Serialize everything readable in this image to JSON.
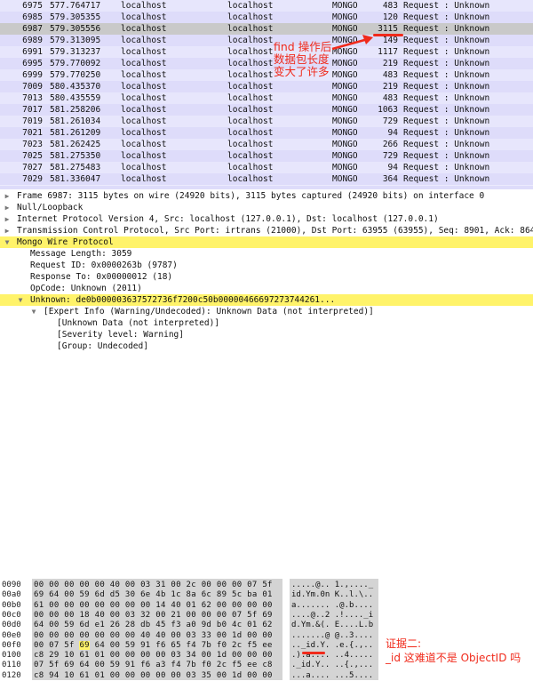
{
  "packet_list": {
    "rows": [
      {
        "no": "6975",
        "time": "577.764717",
        "src": "localhost",
        "dst": "localhost",
        "proto": "MONGO",
        "len": "483",
        "info": "Request : Unknown"
      },
      {
        "no": "6985",
        "time": "579.305355",
        "src": "localhost",
        "dst": "localhost",
        "proto": "MONGO",
        "len": "120",
        "info": "Request : Unknown"
      },
      {
        "no": "6987",
        "time": "579.305556",
        "src": "localhost",
        "dst": "localhost",
        "proto": "MONGO",
        "len": "3115",
        "info": "Request : Unknown",
        "selected": true
      },
      {
        "no": "6989",
        "time": "579.313095",
        "src": "localhost",
        "dst": "localhost",
        "proto": "MONGO",
        "len": "149",
        "info": "Request : Unknown"
      },
      {
        "no": "6991",
        "time": "579.313237",
        "src": "localhost",
        "dst": "localhost",
        "proto": "MONGO",
        "len": "1117",
        "info": "Request : Unknown"
      },
      {
        "no": "6995",
        "time": "579.770092",
        "src": "localhost",
        "dst": "localhost",
        "proto": "MONGO",
        "len": "219",
        "info": "Request : Unknown"
      },
      {
        "no": "6999",
        "time": "579.770250",
        "src": "localhost",
        "dst": "localhost",
        "proto": "MONGO",
        "len": "483",
        "info": "Request : Unknown"
      },
      {
        "no": "7009",
        "time": "580.435370",
        "src": "localhost",
        "dst": "localhost",
        "proto": "MONGO",
        "len": "219",
        "info": "Request : Unknown"
      },
      {
        "no": "7013",
        "time": "580.435559",
        "src": "localhost",
        "dst": "localhost",
        "proto": "MONGO",
        "len": "483",
        "info": "Request : Unknown"
      },
      {
        "no": "7017",
        "time": "581.258206",
        "src": "localhost",
        "dst": "localhost",
        "proto": "MONGO",
        "len": "1063",
        "info": "Request : Unknown"
      },
      {
        "no": "7019",
        "time": "581.261034",
        "src": "localhost",
        "dst": "localhost",
        "proto": "MONGO",
        "len": "729",
        "info": "Request : Unknown"
      },
      {
        "no": "7021",
        "time": "581.261209",
        "src": "localhost",
        "dst": "localhost",
        "proto": "MONGO",
        "len": "94",
        "info": "Request : Unknown"
      },
      {
        "no": "7023",
        "time": "581.262425",
        "src": "localhost",
        "dst": "localhost",
        "proto": "MONGO",
        "len": "266",
        "info": "Request : Unknown"
      },
      {
        "no": "7025",
        "time": "581.275350",
        "src": "localhost",
        "dst": "localhost",
        "proto": "MONGO",
        "len": "729",
        "info": "Request : Unknown"
      },
      {
        "no": "7027",
        "time": "581.275483",
        "src": "localhost",
        "dst": "localhost",
        "proto": "MONGO",
        "len": "94",
        "info": "Request : Unknown"
      },
      {
        "no": "7029",
        "time": "581.336047",
        "src": "localhost",
        "dst": "localhost",
        "proto": "MONGO",
        "len": "364",
        "info": "Request : Unknown"
      }
    ]
  },
  "annotation_find": [
    "find 操作后",
    "数据包长度",
    "变大了许多"
  ],
  "detail_tree": [
    {
      "indent": 0,
      "toggle": "closed",
      "text": "Frame 6987: 3115 bytes on wire (24920 bits), 3115 bytes captured (24920 bits) on interface 0"
    },
    {
      "indent": 0,
      "toggle": "closed",
      "text": "Null/Loopback"
    },
    {
      "indent": 0,
      "toggle": "closed",
      "text": "Internet Protocol Version 4, Src: localhost (127.0.0.1), Dst: localhost (127.0.0.1)"
    },
    {
      "indent": 0,
      "toggle": "closed",
      "text": "Transmission Control Protocol, Src Port: irtrans (21000), Dst Port: 63955 (63955), Seq: 8901, Ack: 864"
    },
    {
      "indent": 0,
      "toggle": "open",
      "text": "Mongo Wire Protocol",
      "highlight": true
    },
    {
      "indent": 1,
      "toggle": "",
      "text": "Message Length: 3059"
    },
    {
      "indent": 1,
      "toggle": "",
      "text": "Request ID: 0x0000263b (9787)"
    },
    {
      "indent": 1,
      "toggle": "",
      "text": "Response To: 0x00000012 (18)"
    },
    {
      "indent": 1,
      "toggle": "",
      "text": "OpCode: Unknown (2011)"
    },
    {
      "indent": 1,
      "toggle": "open",
      "text": "Unknown: de0b000003637572736f7200c50b00000466697273744261...",
      "highlight": true
    },
    {
      "indent": 2,
      "toggle": "open",
      "text": "[Expert Info (Warning/Undecoded): Unknown Data (not interpreted)]"
    },
    {
      "indent": 3,
      "toggle": "",
      "text": "[Unknown Data (not interpreted)]"
    },
    {
      "indent": 3,
      "toggle": "",
      "text": "[Severity level: Warning]"
    },
    {
      "indent": 3,
      "toggle": "",
      "text": "[Group: Undecoded]"
    }
  ],
  "bytes": [
    {
      "off": "0090",
      "hex": "00 00 00 00 00 40 00 03  31 00 2c 00 00 00 07 5f",
      "asc": ".....@..  1.,...._"
    },
    {
      "off": "00a0",
      "hex": "69 64 00 59 6d d5 30 6e  4b 1c 8a 6c 89 5c ba 01",
      "asc": "id.Ym.0n  K..l.\\.."
    },
    {
      "off": "00b0",
      "hex": "61 00 00 00 00 00 00 00  14 40 01 62 00 00 00 00",
      "asc": "a.......  .@.b...."
    },
    {
      "off": "00c0",
      "hex": "00 00 00 18 40 00 03 32  00 21 00 00 00 07 5f 69",
      "asc": "....@..2  .!...._i"
    },
    {
      "off": "00d0",
      "hex": "64 00 59 6d e1 26 28 db  45 f3 a0 9d b0 4c 01 62",
      "asc": "d.Ym.&(.  E....L.b"
    },
    {
      "off": "00e0",
      "hex": "00 00 00 00 00 00 00 40  40 00 03 33 00 1d 00 00",
      "asc": ".......@  @..3...."
    },
    {
      "off": "00f0",
      "hex": "00 07 5f 69 64 00 59 91  f6 65 f4 7b f0 2c f5 ee",
      "asc": ".._id.Y.  .e.{.,.."
    },
    {
      "off": "0100",
      "hex": "c8 29 10 61 01 00 00 00  00 03 34 00 1d 00 00 00",
      "asc": ".).a....  ..4....."
    },
    {
      "off": "0110",
      "hex": "07 5f 69 64 00 59 91 f6  a3 f4 7b f0 2c f5 ee c8",
      "asc": "._id.Y..  ..{.,..."
    },
    {
      "off": "0120",
      "hex": "c8 94 10 61 01 00 00 00  00 00 03 35 00 1d 00 00",
      "asc": "...a....  ...5...."
    }
  ],
  "annotation_evidence": [
    "证据二:",
    "_id 这难道不是 ObjectID 吗"
  ]
}
